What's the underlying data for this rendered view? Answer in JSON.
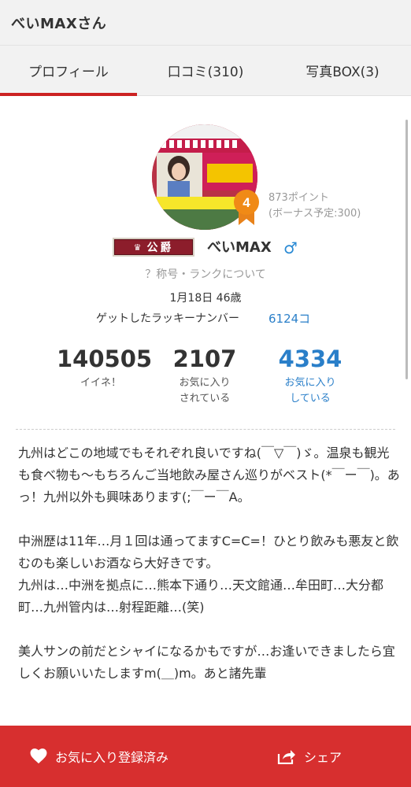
{
  "header": {
    "title": "べいMAXさん"
  },
  "tabs": [
    {
      "label": "プロフィール"
    },
    {
      "label": "口コミ(310)"
    },
    {
      "label": "写真BOX(3)"
    }
  ],
  "profile": {
    "badge_level": "4",
    "points": "873ポイント",
    "bonus": "(ボーナス予定:300)",
    "rank_title": "公爵",
    "username": "べいMAX",
    "gender_symbol": "♂",
    "rank_link": "？称号・ランクについて",
    "birth_age": "1月18日 46歳",
    "lucky_label": "ゲットしたラッキーナンバー",
    "lucky_value": "6124コ",
    "accent_color": "#d72f2f",
    "link_color": "#2a7fc9"
  },
  "stats": [
    {
      "value": "140505",
      "label_line1": "イイネ！",
      "label_line2": ""
    },
    {
      "value": "2107",
      "label_line1": "お気に入り",
      "label_line2": "されている"
    },
    {
      "value": "4334",
      "label_line1": "お気に入り",
      "label_line2": "している"
    }
  ],
  "intro": {
    "p1": "九州はどこの地域でもそれぞれ良いですね(￣▽￣)ゞ。温泉も観光も食べ物も〜もちろんご当地飲み屋さん巡りがベスト(*￣ー￣)。あっ！九州以外も興味あります(;￣ー￣A。",
    "p2_line1": "中洲歴は11年…月１回は通ってますC=C=！ひとり飲みも悪友と飲むのも楽しいお酒なら大好きです。",
    "p2_line2": "九州は…中洲を拠点に…熊本下通り…天文館通…牟田町…大分都町…九州管内は…射程距離…(笑)",
    "p3": "美人サンの前だとシャイになるかもですが…お逢いできましたら宜しくお願いいたしますm(＿)m。あと諸先輩"
  },
  "bottom_bar": {
    "favorite_label": "お気に入り登録済み",
    "share_label": "シェア"
  }
}
